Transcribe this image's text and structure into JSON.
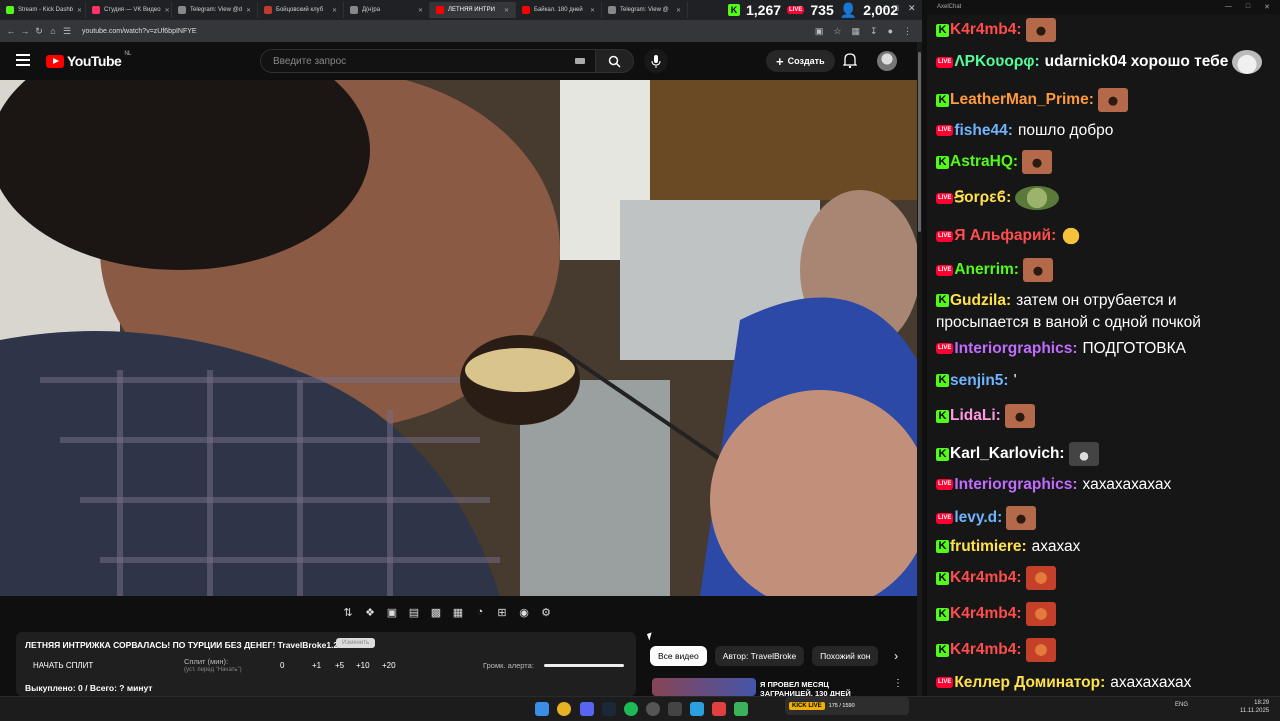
{
  "browser": {
    "tabs": [
      {
        "label": "Stream - Kick Dashb",
        "color": "#53fc18",
        "active": false
      },
      {
        "label": "Студия — VK Видео",
        "color": "#ff3366",
        "active": false
      },
      {
        "label": "Telegram: View @d",
        "color": "#888888",
        "active": false
      },
      {
        "label": "Бойцовский клуб",
        "color": "#c0392b",
        "active": false
      },
      {
        "label": "Д(н)ра",
        "color": "#888888",
        "active": false
      },
      {
        "label": "ЛЕТНЯЯ ИНТРИ",
        "color": "#ff0000",
        "active": true
      },
      {
        "label": "Байкал. 180 дней",
        "color": "#ff0000",
        "active": false
      },
      {
        "label": "Telegram: View @",
        "color": "#888888",
        "active": false
      }
    ],
    "url": "youtube.com/watch?v=zUf6bpINFYE"
  },
  "viewer_counts": {
    "kick": "1,267",
    "vk": "735",
    "total": "2,002",
    "vk_badge": "LIVE"
  },
  "youtube": {
    "logo_text": "YouTube",
    "region": "NL",
    "search_placeholder": "Введите запрос",
    "create_label": "Создать"
  },
  "split_panel": {
    "title": "ЛЕТНЯЯ ИНТРИЖКА СОРВАЛАСЬ! ПО ТУРЦИИ БЕЗ ДЕНЕГ! TravelBroke1.2",
    "pill": "Изменить",
    "start_label": "НАЧАТЬ СПЛИТ",
    "split_label": "Сплит (мин):",
    "split_hint": "(уст. перед \"Начать\")",
    "split_value": "0",
    "increments": [
      "+1",
      "+5",
      "+10",
      "+20"
    ],
    "alert_label": "Громк. алерта:",
    "alert_volume": 1.0,
    "bought": "Выкуплено: 0 / Всего: ? минут"
  },
  "chips": {
    "items": [
      "Все видео",
      "Автор: TravelBroke",
      "Похожий кон"
    ]
  },
  "recommendation": {
    "title": "Я ПРОВЕЛ МЕСЯЦ ЗАГРАНИЦЕЙ. 130 ДНЕЙ"
  },
  "chat": {
    "title": "AxelChat",
    "messages": [
      {
        "platform": "kick",
        "user": "K4r4mb4:",
        "color": "#ff4d4d",
        "text": "",
        "emote": "face"
      },
      {
        "platform": "vk",
        "user": "ɅΡΚοʋορφ:",
        "color": "#53fc98",
        "text": "udarnick04 хорошо тебе",
        "emote": "cat",
        "bold_text": true
      },
      {
        "platform": "kick",
        "user": "LeatherMan_Prime:",
        "color": "#ff9a3c",
        "text": "",
        "emote": "face"
      },
      {
        "platform": "vk",
        "user": "fishe44:",
        "color": "#6fb4ff",
        "text": "пошло добро",
        "emote": ""
      },
      {
        "platform": "kick",
        "user": "AstraHQ:",
        "color": "#53fc18",
        "text": "",
        "emote": "face"
      },
      {
        "platform": "vk",
        "user": "Ꞩοrρεϐ:",
        "color": "#ffe14a",
        "text": "",
        "emote": "frog"
      },
      {
        "platform": "vk",
        "user": "Я Альфарий:",
        "color": "#ff4d4d",
        "text": "",
        "emote": "smile"
      },
      {
        "platform": "vk",
        "user": "Anerrim:",
        "color": "#53fc18",
        "text": "",
        "emote": "face"
      },
      {
        "platform": "kick",
        "user": "Gudzila:",
        "color": "#ffe14a",
        "text": "затем он отрубается и",
        "emote": ""
      },
      {
        "platform": "none",
        "user": "",
        "color": "#ffffff",
        "text": "просыпается в ваной с одной почкой",
        "emote": ""
      },
      {
        "platform": "vk",
        "user": "Interiorgraphics:",
        "color": "#c06cff",
        "text": "ПОДГОТОВКА",
        "emote": ""
      },
      {
        "platform": "kick",
        "user": "senjin5:",
        "color": "#6fb4ff",
        "text": "'",
        "emote": ""
      },
      {
        "platform": "kick",
        "user": "LidaLi:",
        "color": "#ff9ae0",
        "text": "",
        "emote": "face"
      },
      {
        "platform": "kick",
        "user": "Karl_Karlovich:",
        "color": "#ffffff",
        "text": "",
        "emote": "mouth"
      },
      {
        "platform": "vk",
        "user": "Interiorgraphics:",
        "color": "#c06cff",
        "text": "хахахахахах",
        "emote": ""
      },
      {
        "platform": "vk",
        "user": "levy.d:",
        "color": "#6fb4ff",
        "text": "",
        "emote": "face"
      },
      {
        "platform": "kick",
        "user": "frutimiere:",
        "color": "#ffe14a",
        "text": "ахахах",
        "emote": ""
      },
      {
        "platform": "kick",
        "user": "K4r4mb4:",
        "color": "#ff4d4d",
        "text": "",
        "emote": "red"
      },
      {
        "platform": "kick",
        "user": "K4r4mb4:",
        "color": "#ff4d4d",
        "text": "",
        "emote": "red"
      },
      {
        "platform": "kick",
        "user": "K4r4mb4:",
        "color": "#ff4d4d",
        "text": "",
        "emote": "red"
      },
      {
        "platform": "vk",
        "user": "Келлер Доминатор:",
        "color": "#ffe14a",
        "text": "ахахахахах",
        "emote": ""
      }
    ]
  },
  "taskbar": {
    "kick_stamp": "KICK LIVE",
    "kick_stats": "175 / 1590",
    "lang": "ENG",
    "time": "18:29",
    "date": "11.11.2025"
  }
}
